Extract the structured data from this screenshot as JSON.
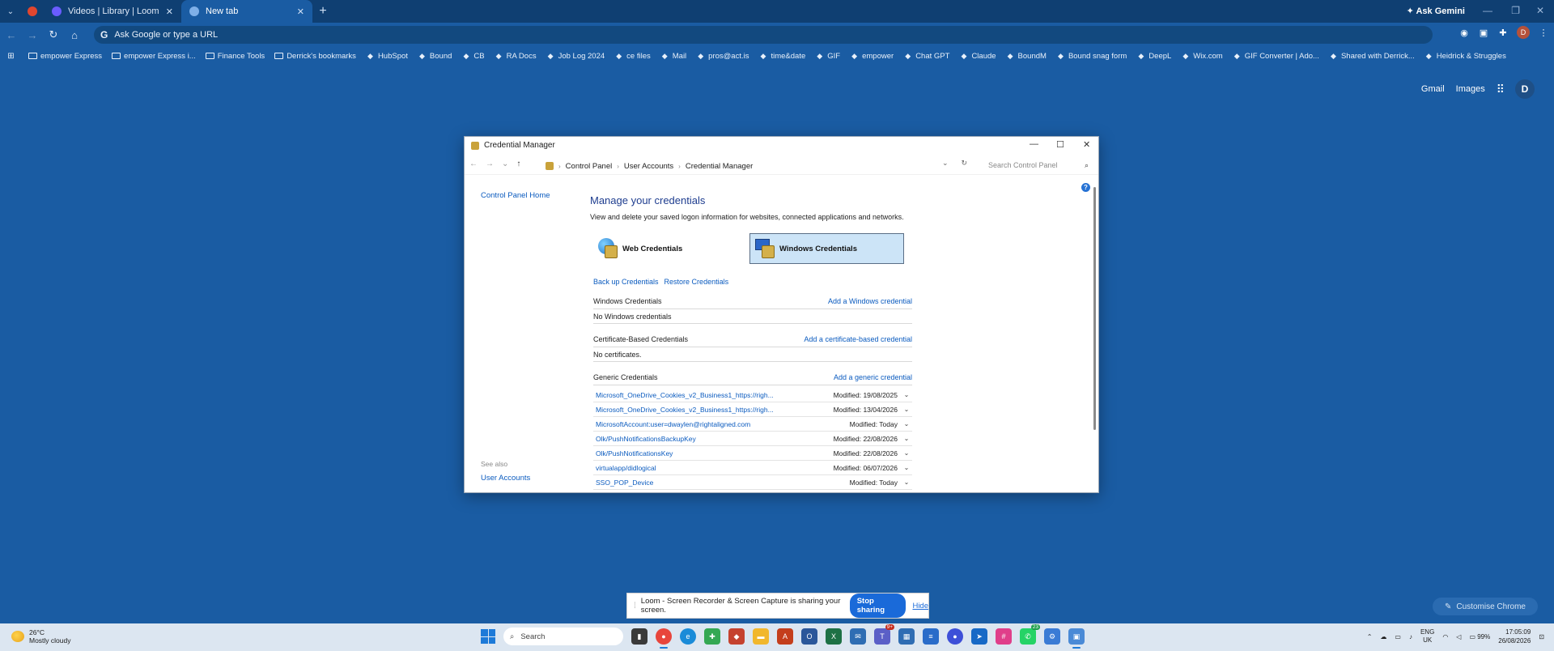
{
  "browser": {
    "tabs": [
      {
        "label": "Videos | Library | Loom",
        "color": "#5a5aff"
      },
      {
        "label": "New tab",
        "color": "#4a90e2"
      }
    ],
    "ask_gemini": "Ask Gemini",
    "omnibox_placeholder": "Ask Google or type a URL",
    "profile_initial": "D"
  },
  "bookmarks": [
    {
      "label": "empower Express",
      "icon": "folder-icon"
    },
    {
      "label": "empower Express i...",
      "icon": "folder-icon"
    },
    {
      "label": "Finance Tools",
      "icon": "folder-icon"
    },
    {
      "label": "Derrick's bookmarks",
      "icon": "folder-icon"
    },
    {
      "label": "HubSpot",
      "icon": "hubspot-icon"
    },
    {
      "label": "Bound",
      "icon": "bound-icon"
    },
    {
      "label": "CB",
      "icon": "cb-icon"
    },
    {
      "label": "RA Docs",
      "icon": "ra-icon"
    },
    {
      "label": "Job Log 2024",
      "icon": "log-icon"
    },
    {
      "label": "ce files",
      "icon": "files-icon"
    },
    {
      "label": "Mail",
      "icon": "mail-icon"
    },
    {
      "label": "pros@act.is",
      "icon": "mail-icon"
    },
    {
      "label": "time&date",
      "icon": "clock-icon"
    },
    {
      "label": "GIF",
      "icon": "gif-icon"
    },
    {
      "label": "empower",
      "icon": "empower-icon"
    },
    {
      "label": "Chat GPT",
      "icon": "chatgpt-icon"
    },
    {
      "label": "Claude",
      "icon": "claude-icon"
    },
    {
      "label": "BoundM",
      "icon": "bound-icon"
    },
    {
      "label": "Bound snag form",
      "icon": "bound-icon"
    },
    {
      "label": "DeepL",
      "icon": "deepl-icon"
    },
    {
      "label": "Wix.com",
      "icon": "wix-icon"
    },
    {
      "label": "GIF Converter | Ado...",
      "icon": "adobe-icon"
    },
    {
      "label": "Shared with Derrick...",
      "icon": "onedrive-icon"
    },
    {
      "label": "Heidrick & Struggles",
      "icon": "hs-icon"
    }
  ],
  "ntp": {
    "gmail": "Gmail",
    "images": "Images",
    "avatar": "D",
    "customise": "Customise Chrome"
  },
  "credential_manager": {
    "window_title": "Credential Manager",
    "breadcrumb": [
      "Control Panel",
      "User Accounts",
      "Credential Manager"
    ],
    "search_placeholder": "Search Control Panel",
    "sidebar_home": "Control Panel Home",
    "see_also": "See also",
    "user_accounts": "User Accounts",
    "heading": "Manage your credentials",
    "description": "View and delete your saved logon information for websites, connected applications and networks.",
    "web_tab": "Web Credentials",
    "windows_tab": "Windows Credentials",
    "backup": "Back up Credentials",
    "restore": "Restore Credentials",
    "windows_section": {
      "title": "Windows Credentials",
      "action": "Add a Windows credential",
      "empty": "No Windows credentials"
    },
    "cert_section": {
      "title": "Certificate-Based Credentials",
      "action": "Add a certificate-based credential",
      "empty": "No certificates."
    },
    "generic_section": {
      "title": "Generic Credentials",
      "action": "Add a generic credential"
    },
    "generic_items": [
      {
        "name": "Microsoft_OneDrive_Cookies_v2_Business1_https://righ...",
        "modified": "Modified:  19/08/2025"
      },
      {
        "name": "Microsoft_OneDrive_Cookies_v2_Business1_https://righ...",
        "modified": "Modified:  13/04/2026"
      },
      {
        "name": "MicrosoftAccount:user=dwaylen@rightaligned.com",
        "modified": "Modified:  Today"
      },
      {
        "name": "Olk/PushNotificationsBackupKey",
        "modified": "Modified:  22/08/2026"
      },
      {
        "name": "Olk/PushNotificationsKey",
        "modified": "Modified:  22/08/2026"
      },
      {
        "name": "virtualapp/didlogical",
        "modified": "Modified:  06/07/2026"
      },
      {
        "name": "SSO_POP_Device",
        "modified": "Modified:  Today"
      }
    ]
  },
  "loom": {
    "message": "Loom - Screen Recorder & Screen Capture is sharing your screen.",
    "stop": "Stop sharing",
    "hide": "Hide"
  },
  "taskbar": {
    "temp": "26°C",
    "condition": "Mostly cloudy",
    "search": "Search",
    "lang_top": "ENG",
    "lang_bottom": "UK",
    "battery": "99%",
    "time": "17:05:09",
    "date": "26/08/2026",
    "badge_teams": "9+",
    "badge_whatsapp": "23"
  }
}
